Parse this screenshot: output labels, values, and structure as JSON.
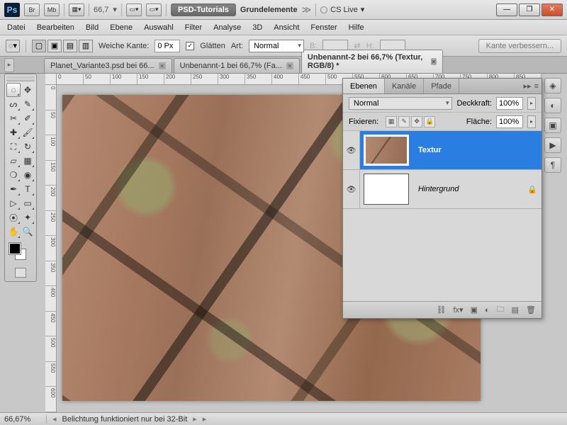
{
  "titlebar": {
    "zoom": "66,7",
    "brand": "PSD-Tutorials",
    "doc": "Grundelemente",
    "cslive": "CS Live"
  },
  "menu": [
    "Datei",
    "Bearbeiten",
    "Bild",
    "Ebene",
    "Auswahl",
    "Filter",
    "Analyse",
    "3D",
    "Ansicht",
    "Fenster",
    "Hilfe"
  ],
  "optbar": {
    "feather_label": "Weiche Kante:",
    "feather_value": "0 Px",
    "antialias": "Glätten",
    "style_label": "Art:",
    "style_value": "Normal",
    "width_label": "B:",
    "height_label": "H:",
    "refine": "Kante verbessern..."
  },
  "doctabs": [
    {
      "label": "Planet_Variante3.psd bei 66...",
      "active": false
    },
    {
      "label": "Unbenannt-1 bei 66,7% (Fa...",
      "active": false
    },
    {
      "label": "Unbenannt-2 bei 66,7% (Textur, RGB/8) *",
      "active": true
    }
  ],
  "ruler_h": [
    "0",
    "50",
    "100",
    "150",
    "200",
    "250",
    "300",
    "350",
    "400",
    "450",
    "500",
    "550",
    "600",
    "650",
    "700",
    "750",
    "800",
    "850"
  ],
  "ruler_v": [
    "0",
    "50",
    "100",
    "150",
    "200",
    "250",
    "300",
    "350",
    "400",
    "450",
    "500",
    "550",
    "600"
  ],
  "panel": {
    "tabs": [
      "Ebenen",
      "Kanäle",
      "Pfade"
    ],
    "blend": "Normal",
    "opacity_label": "Deckkraft:",
    "opacity_value": "100%",
    "lock_label": "Fixieren:",
    "fill_label": "Fläche:",
    "fill_value": "100%",
    "layers": [
      {
        "name": "Textur",
        "selected": true,
        "visible": true,
        "locked": false,
        "thumb": "tex"
      },
      {
        "name": "Hintergrund",
        "selected": false,
        "visible": true,
        "locked": true,
        "thumb": "white"
      }
    ]
  },
  "status": {
    "zoom": "66,67%",
    "msg": "Belichtung funktioniert nur bei 32-Bit"
  }
}
